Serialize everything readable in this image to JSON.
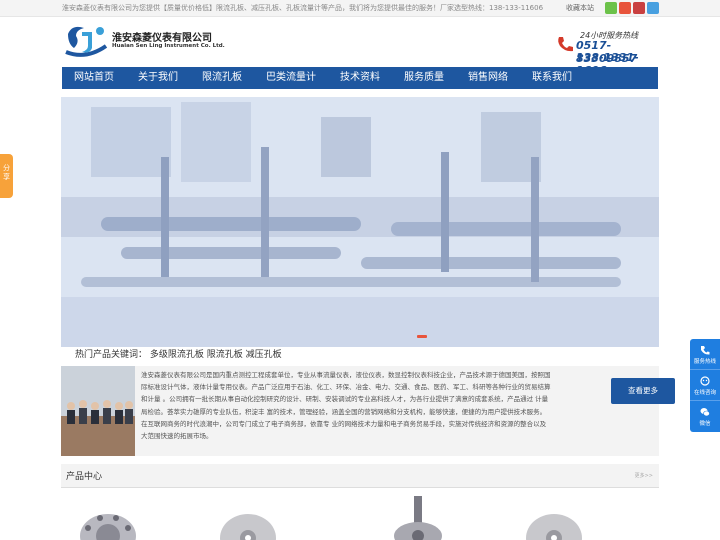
{
  "topbar": {
    "notice": "淮安森菱仪表有限公司为您提供【质量优价格低】限流孔板、减压孔板、孔板流量计等产品，我们将为您提供最佳的服务！厂家选型热线：138-133-11606",
    "favorite": "收藏本站"
  },
  "logo": {
    "name_cn": "淮安森菱仪表有限公司",
    "name_en": "Huaian Sen Ling Instrument Co. Ltd."
  },
  "hotline": {
    "caption": "24小时服务热线",
    "phone1": "0517-83309857",
    "phone2": "138-1331-1606"
  },
  "nav": [
    "网站首页",
    "关于我们",
    "限流孔板",
    "巴类流量计",
    "技术资料",
    "服务质量",
    "销售网络",
    "联系我们"
  ],
  "hot_keywords": {
    "label": "热门产品关键词：",
    "items": "多级限流孔板 限流孔板 减压孔板"
  },
  "about": {
    "text": "淮安森菱仪表有限公司是国内重点测控工程成套单位，专业从事流量仪表，液位仪表，数显控制仪表科技企业，产品技术源于德国美国，按照国际标准设计气体，液体计量专用仪表。产品广泛应用于石油、化工、环保、冶金、电力、交通、食品、医药、军工、科研等各种行业的贸易结算和计量 。公司拥有一批长期从事自动化控制研究的设计、研制、安装调试的专业高科技人才，为各行业提供了满意的成套系统，产品通过 计量局检验。荟萃实力雄厚的专业队伍，积淀丰 富的技术，管理经验，涵盖全国的营销网络和分支机构，能够快速，便捷的为用户提供技术服务。在互联网商务的时代浪潮中，公司专门成立了电子商务部，依靠专 业的网络技术力量和电子商务贸易手段，实施对传统经济和资源的整合以及大范围快速的拓展市场。",
    "more": "查看更多"
  },
  "products": {
    "title": "产品中心",
    "more": "更多>>"
  },
  "share": "分享",
  "float_service": [
    "服务热线",
    "在线咨询",
    "微信"
  ],
  "colors": {
    "brand_blue": "#1e57a0",
    "float_blue": "#1f7ee0",
    "share_orange": "#f7a23a",
    "slider_dot": "#e8543c"
  }
}
